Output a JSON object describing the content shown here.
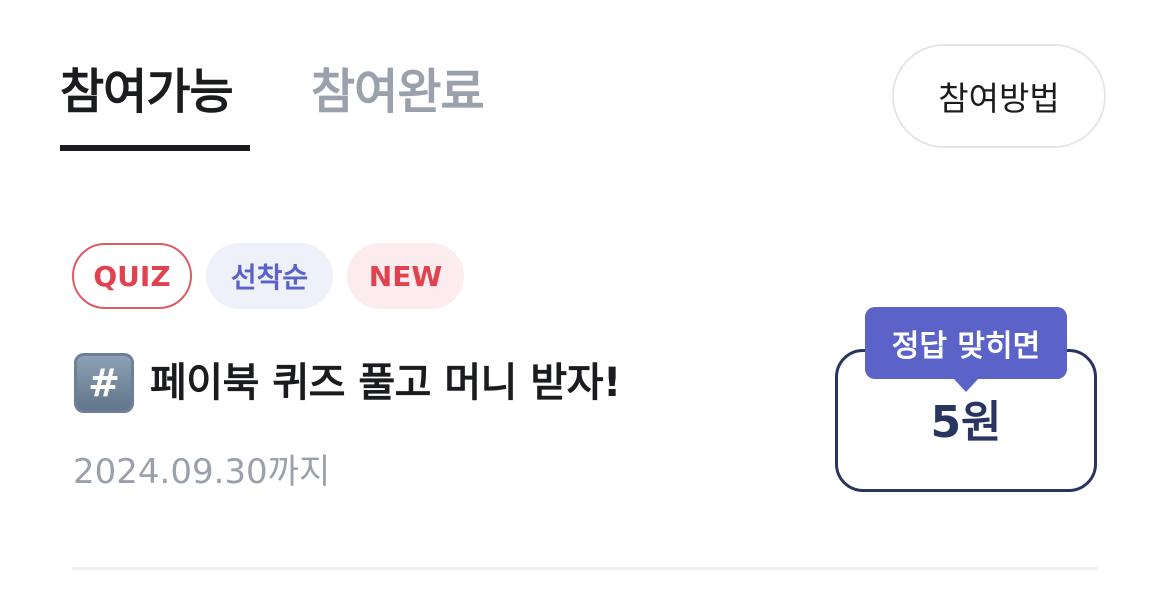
{
  "tabs": [
    {
      "label": "참여가능",
      "active": true
    },
    {
      "label": "참여완료",
      "active": false
    }
  ],
  "how_button_label": "참여방법",
  "card": {
    "badges": [
      {
        "label": "QUIZ"
      },
      {
        "label": "선착순"
      },
      {
        "label": "NEW"
      }
    ],
    "icon": "#️⃣",
    "icon_name": "hash-keycap-icon",
    "title": "페이북 퀴즈 풀고 머니 받자!",
    "deadline": "2024.09.30까지",
    "reward": {
      "tooltip": "정답 맞히면",
      "amount": "5원"
    }
  },
  "colors": {
    "text_primary": "#1b1c1f",
    "text_muted": "#9aa1ad",
    "accent_red": "#e0434f",
    "accent_indigo": "#5b63c9",
    "navy": "#283560"
  }
}
